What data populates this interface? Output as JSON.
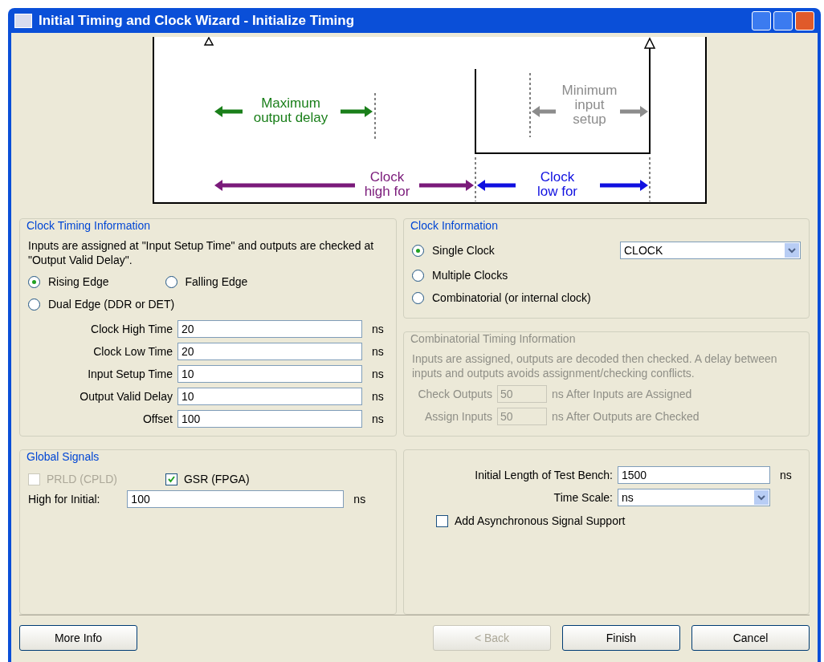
{
  "window": {
    "title": "Initial Timing and Clock Wizard - Initialize Timing"
  },
  "diagram": {
    "max_output_delay": [
      "Maximum",
      "output delay"
    ],
    "min_input_setup": [
      "Minimum",
      "input",
      "setup"
    ],
    "clock_high": [
      "Clock",
      "high for"
    ],
    "clock_low": [
      "Clock",
      "low for"
    ]
  },
  "clock_timing": {
    "title": "Clock Timing Information",
    "note": "Inputs are assigned at \"Input Setup Time\" and outputs are checked at \"Output Valid Delay\".",
    "edges": [
      {
        "label": "Rising Edge",
        "selected": true
      },
      {
        "label": "Falling Edge",
        "selected": false
      },
      {
        "label": "Dual Edge (DDR or DET)",
        "selected": false
      }
    ],
    "fields": [
      {
        "label": "Clock High Time",
        "value": "20",
        "unit": "ns"
      },
      {
        "label": "Clock Low Time",
        "value": "20",
        "unit": "ns"
      },
      {
        "label": "Input Setup Time",
        "value": "10",
        "unit": "ns"
      },
      {
        "label": "Output Valid Delay",
        "value": "10",
        "unit": "ns"
      },
      {
        "label": "Offset",
        "value": "100",
        "unit": "ns"
      }
    ]
  },
  "clock_information": {
    "title": "Clock Information",
    "options": [
      {
        "label": "Single Clock",
        "selected": true
      },
      {
        "label": "Multiple Clocks",
        "selected": false
      },
      {
        "label": "Combinatorial (or internal clock)",
        "selected": false
      }
    ],
    "clock_select": "CLOCK"
  },
  "combinatorial": {
    "title": "Combinatorial Timing Information",
    "disabled": true,
    "note": "Inputs are assigned, outputs are decoded then checked.  A delay between inputs and outputs avoids assignment/checking conflicts.",
    "fields": [
      {
        "label": "Check Outputs",
        "value": "50",
        "after": "ns After Inputs are Assigned"
      },
      {
        "label": "Assign Inputs",
        "value": "50",
        "after": "ns After Outputs are Checked"
      }
    ]
  },
  "global_signals": {
    "title": "Global Signals",
    "checks": [
      {
        "label": "PRLD (CPLD)",
        "checked": false,
        "disabled": true
      },
      {
        "label": "GSR (FPGA)",
        "checked": true,
        "disabled": false
      }
    ],
    "field": {
      "label": "High for Initial:",
      "value": "100",
      "unit": "ns"
    }
  },
  "test_bench": {
    "length": {
      "label": "Initial Length of Test Bench:",
      "value": "1500",
      "unit": "ns"
    },
    "time_scale": {
      "label": "Time Scale:",
      "value": "ns"
    },
    "async": {
      "label": "Add Asynchronous Signal Support",
      "checked": false
    }
  },
  "buttons": [
    {
      "label": "More Info",
      "disabled": false
    },
    {
      "label": "< Back",
      "disabled": true
    },
    {
      "label": "Finish",
      "disabled": false
    },
    {
      "label": "Cancel",
      "disabled": false
    }
  ]
}
